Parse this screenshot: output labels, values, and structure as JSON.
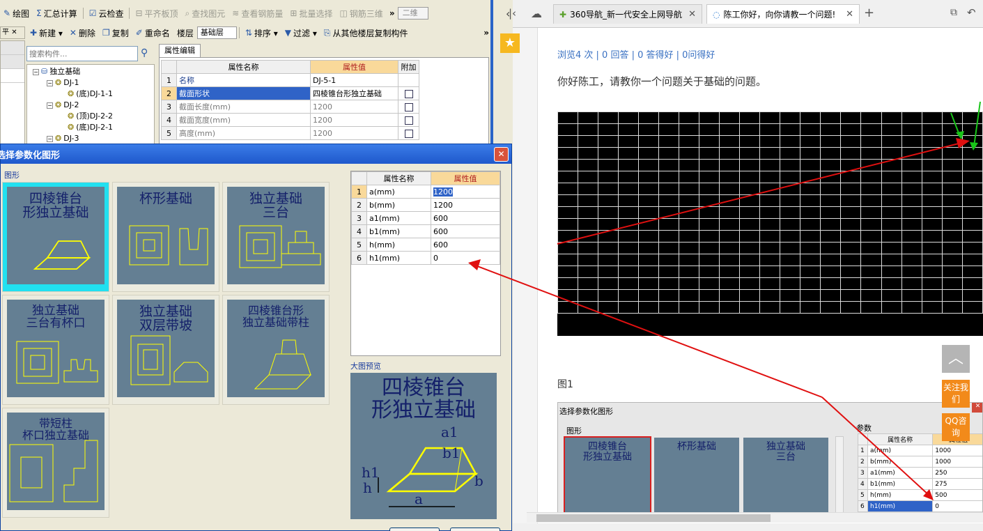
{
  "left_app": {
    "toolbar1": [
      {
        "icon": "draw-icon",
        "label": "绘图",
        "enabled": true
      },
      {
        "icon": "sum-icon",
        "label": "汇总计算",
        "enabled": true
      },
      {
        "icon": "check-icon",
        "label": "云检查",
        "enabled": true
      },
      {
        "icon": "level-slab-icon",
        "label": "平齐板顶",
        "enabled": false
      },
      {
        "icon": "find-icon",
        "label": "查找图元",
        "enabled": false
      },
      {
        "icon": "rebar-icon",
        "label": "查看钢筋量",
        "enabled": false
      },
      {
        "icon": "batch-icon",
        "label": "批量选择",
        "enabled": false
      },
      {
        "icon": "rebar3d-icon",
        "label": "钢筋三维",
        "enabled": false
      }
    ],
    "view_select": "二维",
    "toolbar2": [
      {
        "icon": "new-icon",
        "label": "新建",
        "dropdown": true
      },
      {
        "icon": "delete-icon",
        "label": "删除"
      },
      {
        "icon": "copy-icon",
        "label": "复制"
      },
      {
        "icon": "rename-icon",
        "label": "重命名"
      },
      {
        "icon": "",
        "label": "楼层"
      }
    ],
    "floor_select": "基础层",
    "toolbar2b": [
      {
        "icon": "sort-icon",
        "label": "排序",
        "dropdown": true
      },
      {
        "icon": "filter-icon",
        "label": "过滤",
        "dropdown": true
      },
      {
        "icon": "copy-floor-icon",
        "label": "从其他楼层复制构件"
      }
    ],
    "search_placeholder": "搜索构件...",
    "tree": {
      "root": "独立基础",
      "items": [
        {
          "label": "DJ-1",
          "level": 1,
          "expand": "-"
        },
        {
          "label": "(底)DJ-1-1",
          "level": 2
        },
        {
          "label": "DJ-2",
          "level": 1,
          "expand": "-"
        },
        {
          "label": "(顶)DJ-2-2",
          "level": 2
        },
        {
          "label": "(底)DJ-2-1",
          "level": 2
        },
        {
          "label": "DJ-3",
          "level": 1,
          "expand": "-"
        }
      ]
    },
    "prop_tab": "属性编辑",
    "prop_headers": [
      "属性名称",
      "属性值",
      "附加"
    ],
    "prop_rows": [
      {
        "no": "1",
        "name": "名称",
        "value": "DJ-5-1",
        "check": false
      },
      {
        "no": "2",
        "name": "截面形状",
        "value": "四棱锥台形独立基础",
        "check": true
      },
      {
        "no": "3",
        "name": "截面长度(mm)",
        "value": "1200",
        "check": true
      },
      {
        "no": "4",
        "name": "截面宽度(mm)",
        "value": "1200",
        "check": true
      },
      {
        "no": "5",
        "name": "高度(mm)",
        "value": "1200",
        "check": true
      }
    ]
  },
  "dialog": {
    "title": "选择参数化图形",
    "group_label": "图形",
    "shapes": [
      {
        "lines": [
          "四棱锥台",
          "形独立基础"
        ],
        "selected": true
      },
      {
        "lines": [
          "杯形基础"
        ]
      },
      {
        "lines": [
          "独立基础",
          "三台"
        ]
      },
      {
        "lines": [
          "独立基础",
          "三台有杯口"
        ]
      },
      {
        "lines": [
          "独立基础",
          "双层带坡"
        ]
      },
      {
        "lines": [
          "四棱锥台形",
          "独立基础带柱"
        ]
      },
      {
        "lines": [
          "带短柱",
          "杯口独立基础"
        ]
      }
    ],
    "param_headers": [
      "属性名称",
      "属性值"
    ],
    "params": [
      {
        "no": "1",
        "name": "a(mm)",
        "value": "1200"
      },
      {
        "no": "2",
        "name": "b(mm)",
        "value": "1200"
      },
      {
        "no": "3",
        "name": "a1(mm)",
        "value": "600"
      },
      {
        "no": "4",
        "name": "b1(mm)",
        "value": "600"
      },
      {
        "no": "5",
        "name": "h(mm)",
        "value": "600"
      },
      {
        "no": "6",
        "name": "h1(mm)",
        "value": "0"
      }
    ],
    "preview_label": "大图预览",
    "preview_lines": [
      "四棱锥台",
      "形独立基础"
    ]
  },
  "browser": {
    "tabs": [
      {
        "label": "360导航_新一代安全上网导航",
        "active": false
      },
      {
        "label": "陈工你好，向你请教一个问题!",
        "active": true
      }
    ],
    "stats": "浏览4 次 | 0 回答 | 0 答得好 | 0问得好",
    "question": "你好陈工，请教你一个问题关于基础的问题。",
    "figure_caption": "图1",
    "side_buttons": {
      "follow": "关注我们",
      "qq": "QQ咨询"
    },
    "embedded": {
      "title": "选择参数化图形",
      "group": "图形",
      "param_group": "参数",
      "headers": [
        "属性名称",
        "属性值"
      ],
      "shapes": [
        [
          "四棱锥台",
          "形独立基础"
        ],
        [
          "杯形基础"
        ],
        [
          "独立基础",
          "三台"
        ]
      ],
      "rows": [
        {
          "no": "1",
          "name": "a(mm)",
          "value": "1000"
        },
        {
          "no": "2",
          "name": "b(mm)",
          "value": "1000"
        },
        {
          "no": "3",
          "name": "a1(mm)",
          "value": "250"
        },
        {
          "no": "4",
          "name": "b1(mm)",
          "value": "275"
        },
        {
          "no": "5",
          "name": "h(mm)",
          "value": "500"
        },
        {
          "no": "6",
          "name": "h1(mm)",
          "value": "0"
        }
      ]
    }
  },
  "colors": {
    "accent": "#2f63c7",
    "header_orange": "#f9d99a",
    "arrow": "#e01010",
    "shape_bg": "#647f93",
    "dialog_title": "#2a64c8"
  }
}
